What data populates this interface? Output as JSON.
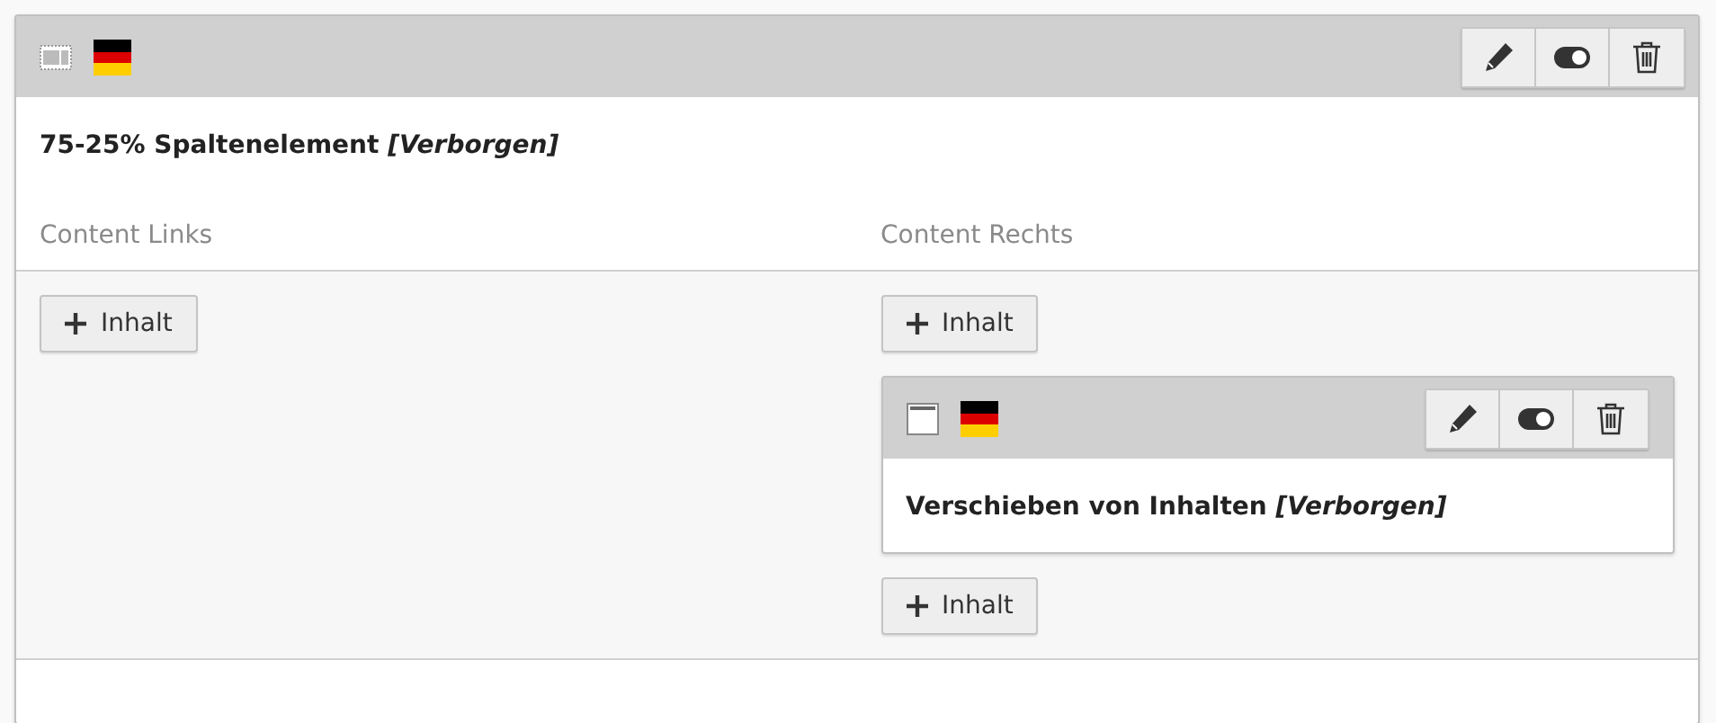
{
  "element": {
    "title": "75-25% Spaltenelement *[Verborgen]*",
    "columns": [
      {
        "heading": "Content Links",
        "items": [
          {
            "kind": "add",
            "label": "Inhalt"
          }
        ]
      },
      {
        "heading": "Content Rechts",
        "items": [
          {
            "kind": "add",
            "label": "Inhalt"
          },
          {
            "kind": "element",
            "title": "Verschieben von Inhalten *[Verborgen]*"
          },
          {
            "kind": "add",
            "label": "Inhalt"
          }
        ]
      }
    ]
  }
}
